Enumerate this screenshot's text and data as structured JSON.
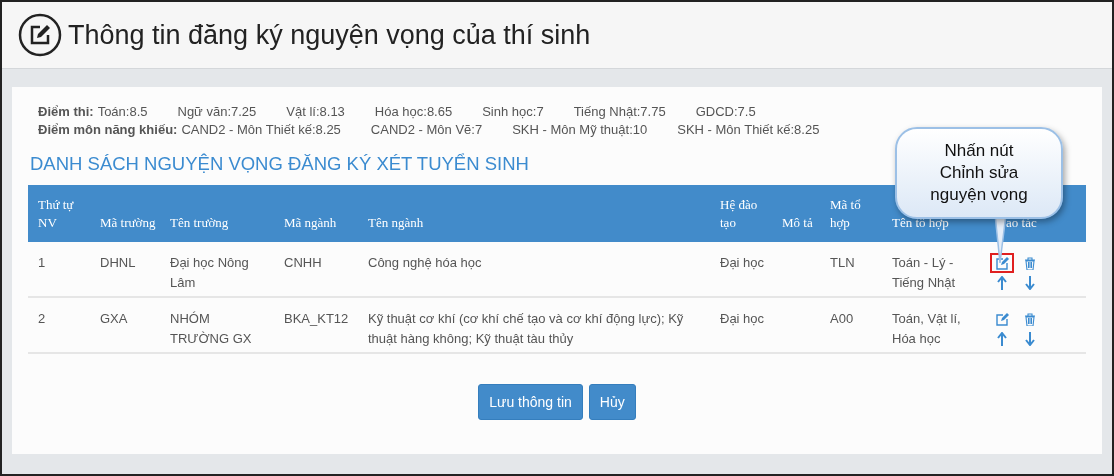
{
  "page_title": "Thông tin đăng ký nguyện vọng của thí sinh",
  "scores": {
    "exam_label": "Điểm thi:",
    "exam": [
      "Toán:8.5",
      "Ngữ văn:7.25",
      "Vật lí:8.13",
      "Hóa học:8.65",
      "Sinh học:7",
      "Tiếng Nhật:7.75",
      "GDCD:7.5"
    ],
    "talent_label": "Điểm môn năng khiếu:",
    "talent": [
      "CAND2 - Môn Thiết kế:8.25",
      "CAND2 - Môn Vẽ:7",
      "SKH - Môn Mỹ thuật:10",
      "SKH - Môn Thiết kế:8.25"
    ]
  },
  "section_title": "DANH SÁCH NGUYỆN VỌNG ĐĂNG KÝ XÉT TUYỂN SINH",
  "table": {
    "columns": [
      "Thứ tự NV",
      "Mã trường",
      "Tên trường",
      "Mã ngành",
      "Tên ngành",
      "Hệ đào tạo",
      "Mô tả",
      "Mã tổ hợp",
      "Tên tổ hợp",
      "ao tác"
    ],
    "rows": [
      {
        "cells": [
          "1",
          "DHNL",
          "Đại học Nông Lâm",
          "CNHH",
          "Công nghệ hóa học",
          "Đại học",
          "",
          "TLN",
          "Toán - Lý - Tiếng Nhật"
        ],
        "edit_highlighted": true
      },
      {
        "cells": [
          "2",
          "GXA",
          "NHÓM TRƯỜNG GX",
          "BKA_KT12",
          "Kỹ thuật cơ khí (cơ khí chế tạo và cơ khí động lực); Kỹ thuật hàng không; Kỹ thuật tàu thủy",
          "Đại học",
          "",
          "A00",
          "Toán, Vật lí, Hóa học"
        ],
        "edit_highlighted": false
      }
    ]
  },
  "callout": "Nhấn nút Chỉnh sửa nguyện vọng",
  "buttons": [
    "Lưu thông tin",
    "Hủy"
  ]
}
